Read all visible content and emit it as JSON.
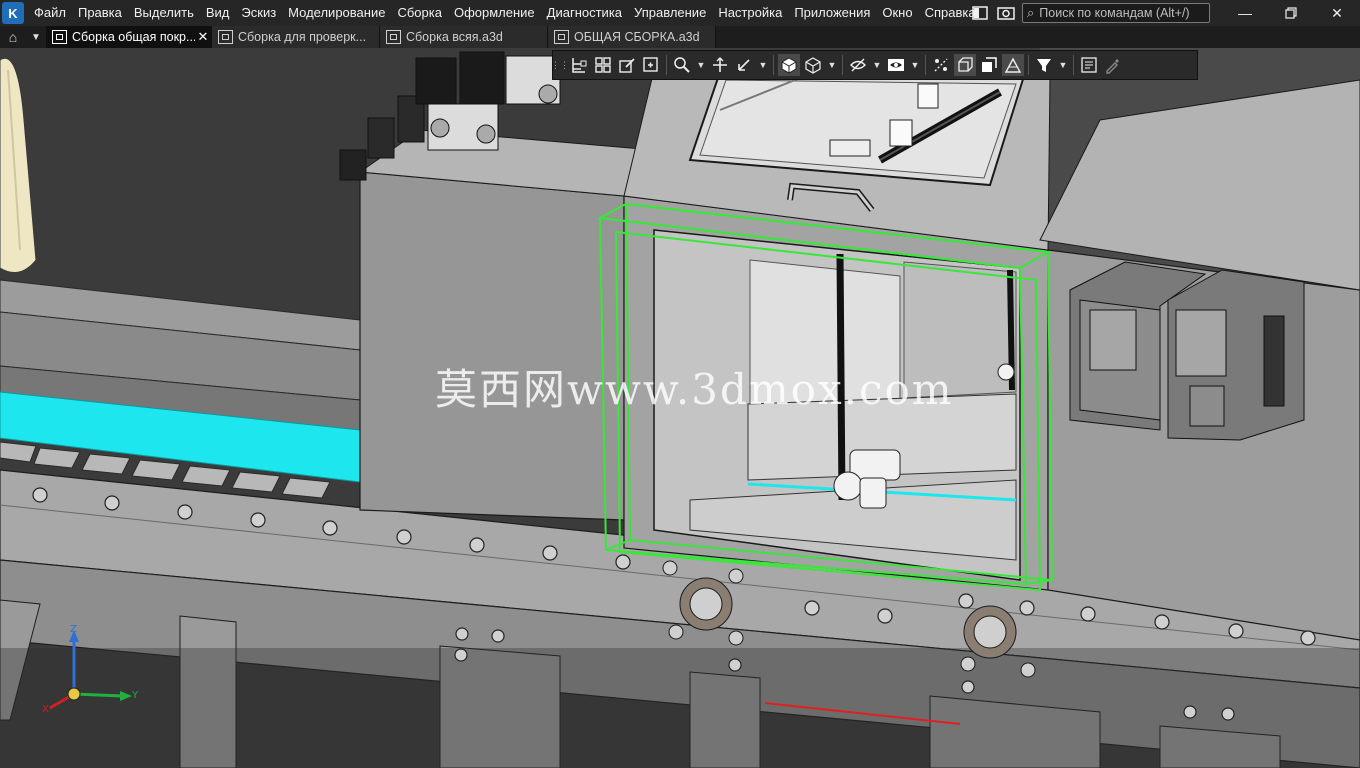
{
  "app": {
    "logo_letter": "K"
  },
  "menu": {
    "items": [
      "Файл",
      "Правка",
      "Выделить",
      "Вид",
      "Эскиз",
      "Моделирование",
      "Сборка",
      "Оформление",
      "Диагностика",
      "Управление",
      "Настройка",
      "Приложения",
      "Окно",
      "Справка"
    ]
  },
  "search": {
    "placeholder": "Поиск по командам (Alt+/)"
  },
  "tabs": [
    {
      "label": "Сборка общая покр...",
      "active": true
    },
    {
      "label": "Сборка для проверк...",
      "active": false
    },
    {
      "label": "Сборка всяя.a3d",
      "active": false
    },
    {
      "label": "ОБЩАЯ СБОРКА.a3d",
      "active": false
    }
  ],
  "watermark": {
    "text": "莫西网www.3dmox.com"
  },
  "axes": {
    "x_label": "X",
    "y_label": "Y",
    "z_label": "Z",
    "x_color": "#d02020",
    "y_color": "#20b040",
    "z_color": "#2f6fd6"
  },
  "colors": {
    "selection_box": "#39e639",
    "conveyor_cyan": "#1ee6ee",
    "red_line": "#e02020"
  },
  "view_toolbar": {
    "buttons": [
      "tree-icon",
      "layers-icon",
      "edit-icon",
      "zoom-icon",
      "pan-icon",
      "rotate-icon",
      "orientation-cube-icon",
      "wireframe-cube-icon",
      "hide-icon",
      "visibility-icon",
      "section-icon",
      "box-view-icon",
      "shading-icon",
      "perspective-icon",
      "filter-icon",
      "properties-icon",
      "eyedropper-icon"
    ]
  }
}
